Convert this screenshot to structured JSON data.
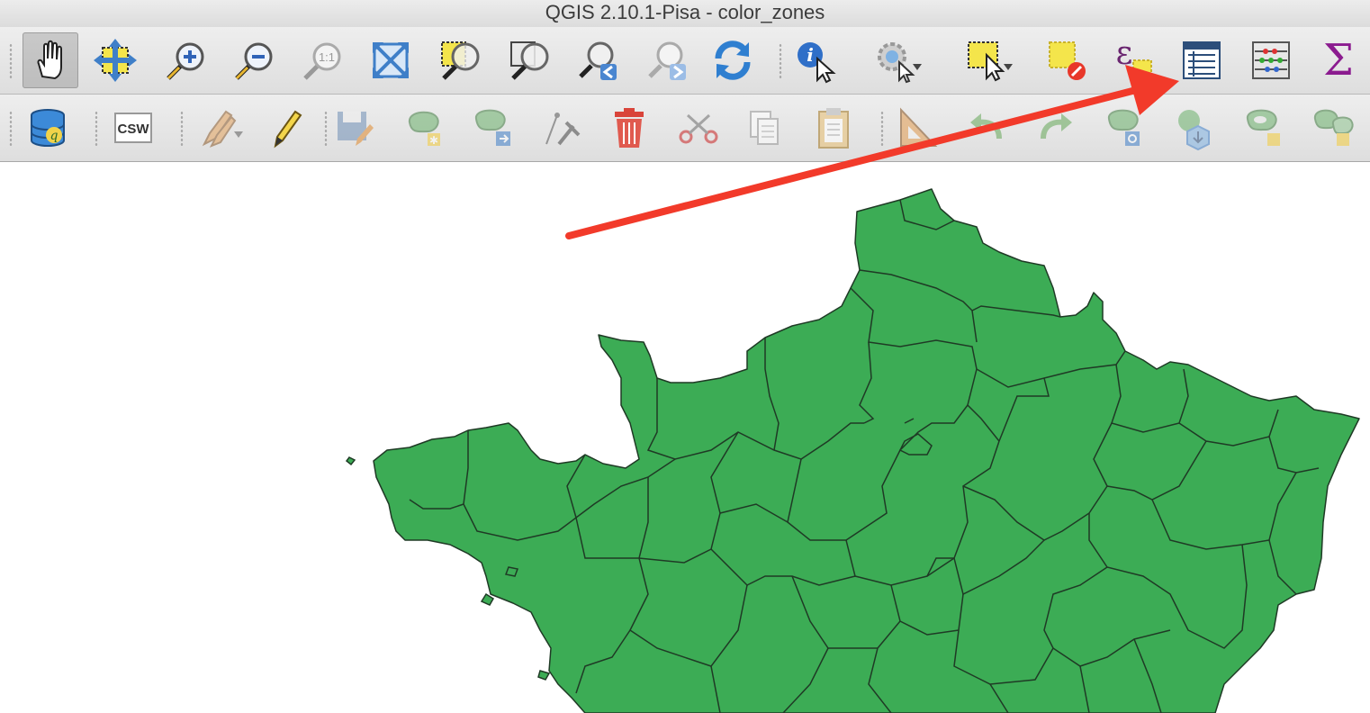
{
  "window": {
    "title": "QGIS 2.10.1-Pisa - color_zones"
  },
  "toolbar_map_nav": {
    "tools": [
      {
        "icon": "pan-hand-icon",
        "active": true
      },
      {
        "icon": "pan-to-selection-icon"
      },
      {
        "icon": "zoom-in-icon"
      },
      {
        "icon": "zoom-out-icon"
      },
      {
        "icon": "zoom-native-icon",
        "label": "1:1"
      },
      {
        "icon": "zoom-full-icon"
      },
      {
        "icon": "zoom-to-selection-icon"
      },
      {
        "icon": "zoom-to-layer-icon"
      },
      {
        "icon": "zoom-last-icon"
      },
      {
        "icon": "zoom-next-icon"
      },
      {
        "icon": "refresh-icon"
      }
    ]
  },
  "toolbar_attributes": {
    "tools": [
      {
        "icon": "identify-features-icon"
      },
      {
        "icon": "run-feature-action-icon",
        "dropdown": true
      },
      {
        "icon": "select-features-icon",
        "dropdown": true
      },
      {
        "icon": "deselect-all-icon"
      },
      {
        "icon": "select-by-expression-icon",
        "symbol": "ε"
      },
      {
        "icon": "open-attribute-table-icon"
      },
      {
        "icon": "field-calculator-icon"
      },
      {
        "icon": "statistical-summary-icon",
        "symbol": "Σ"
      }
    ]
  },
  "toolbar_digitizing": {
    "tools": [
      {
        "icon": "db-manager-icon"
      },
      {
        "icon": "csw-icon",
        "label": "CSW"
      },
      {
        "icon": "current-edits-icon",
        "dropdown": true
      },
      {
        "icon": "toggle-editing-icon"
      },
      {
        "icon": "save-layer-edits-icon"
      },
      {
        "icon": "add-feature-icon"
      },
      {
        "icon": "move-feature-icon"
      },
      {
        "icon": "node-tool-icon"
      },
      {
        "icon": "delete-selected-icon"
      },
      {
        "icon": "cut-features-icon"
      },
      {
        "icon": "copy-features-icon"
      },
      {
        "icon": "paste-features-icon"
      },
      {
        "icon": "measure-icon"
      },
      {
        "icon": "undo-icon"
      },
      {
        "icon": "redo-icon"
      },
      {
        "icon": "rotate-feature-icon"
      },
      {
        "icon": "simplify-feature-icon"
      },
      {
        "icon": "add-ring-icon"
      },
      {
        "icon": "add-part-icon"
      }
    ]
  },
  "map": {
    "layer": "color_zones",
    "fill_color": "#3cac55",
    "stroke_color": "#1f3a25"
  },
  "annotation": {
    "arrow_color": "#f23a2a",
    "points_to": "open-attribute-table-icon"
  }
}
